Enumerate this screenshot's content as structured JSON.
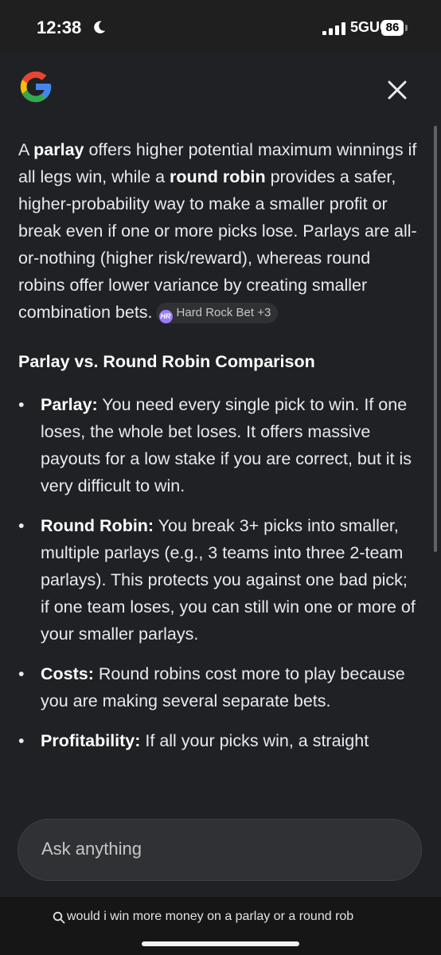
{
  "status_bar": {
    "time": "12:38",
    "network": "5GUC",
    "battery": "86"
  },
  "answer": {
    "intro": [
      {
        "text": "A ",
        "bold": false
      },
      {
        "text": "parlay",
        "bold": true
      },
      {
        "text": " offers higher potential maximum winnings if all legs win, while a ",
        "bold": false
      },
      {
        "text": "round robin",
        "bold": true
      },
      {
        "text": " provides a safer, higher-probability way to make a smaller profit or break even if one or more picks lose. Parlays are all-or-nothing (higher risk/reward), whereas round robins offer lower variance by creating smaller combination bets.",
        "bold": false
      }
    ],
    "source_chip": {
      "icon_text": "HR",
      "label": "Hard Rock Bet +3"
    },
    "section_heading": "Parlay vs. Round Robin Comparison",
    "points": [
      {
        "term": "Parlay:",
        "text": " You need every single pick to win. If one loses, the whole bet loses. It offers massive payouts for a low stake if you are correct, but it is very difficult to win."
      },
      {
        "term": "Round Robin:",
        "text": " You break 3+ picks into smaller, multiple parlays (e.g., 3 teams into three 2-team parlays). This protects you against one bad pick; if one team loses, you can still win one or more of your smaller parlays."
      },
      {
        "term": "Costs:",
        "text": " Round robins cost more to play because you are making several separate bets."
      },
      {
        "term": "Profitability:",
        "text": " If all your picks win, a straight"
      }
    ]
  },
  "ask_box": {
    "placeholder": "Ask anything"
  },
  "query_bar": {
    "text": "would i win more money on a parlay or a round rob"
  },
  "colors": {
    "google_blue": "#4285F4",
    "google_red": "#EA4335",
    "google_yellow": "#FBBC05",
    "google_green": "#34A853",
    "sheet_bg": "#202124"
  }
}
